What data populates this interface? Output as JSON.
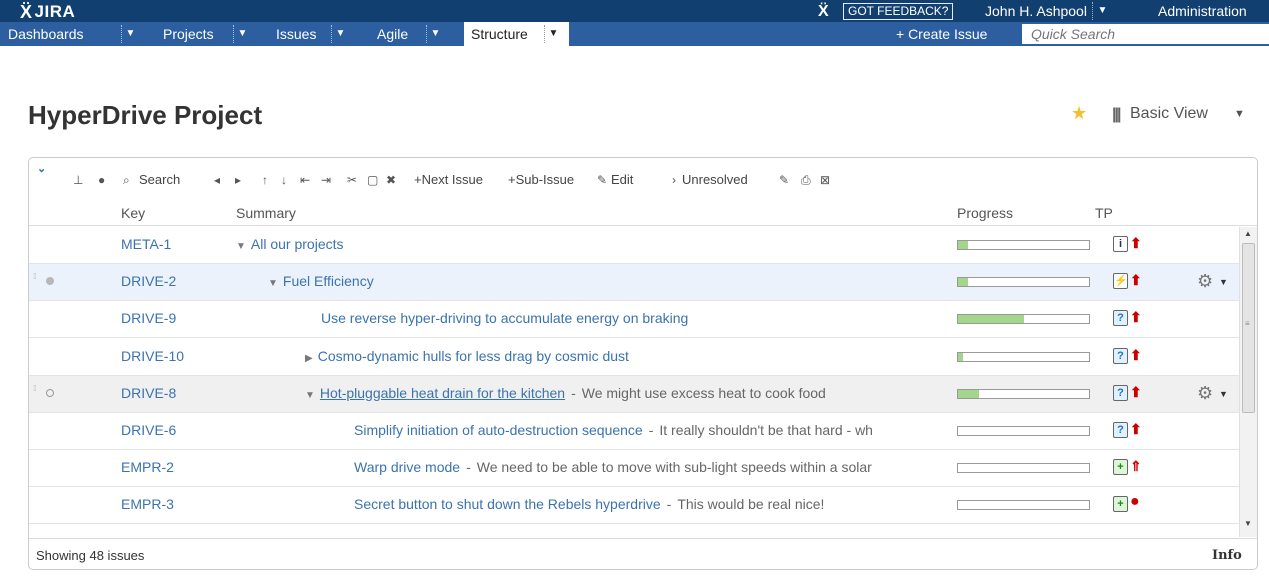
{
  "app": {
    "logo_text": "JIRA",
    "feedback_label": "GOT FEEDBACK?",
    "user_name": "John H. Ashpool",
    "admin_label": "Administration"
  },
  "nav": {
    "items": [
      {
        "label": "Dashboards"
      },
      {
        "label": "Projects"
      },
      {
        "label": "Issues"
      },
      {
        "label": "Agile"
      },
      {
        "label": "Structure"
      }
    ],
    "create_label": "+ Create Issue",
    "quick_search_placeholder": "Quick Search"
  },
  "page": {
    "title": "HyperDrive Project",
    "view_label": "Basic View"
  },
  "toolbar": {
    "search": "Search",
    "next_issue": "+Next Issue",
    "sub_issue": "+Sub-Issue",
    "edit": "Edit",
    "unresolved": "Unresolved"
  },
  "columns": {
    "key": "Key",
    "summary": "Summary",
    "progress": "Progress",
    "tp": "TP"
  },
  "rows": [
    {
      "key": "META-1",
      "arrow": "▼",
      "summary": "All our projects",
      "desc": "",
      "progress": 0.08,
      "type": "info",
      "priority": "major"
    },
    {
      "key": "DRIVE-2",
      "arrow": "▼",
      "summary": "Fuel Efficiency",
      "desc": "",
      "progress": 0.08,
      "type": "epic",
      "priority": "major"
    },
    {
      "key": "DRIVE-9",
      "arrow": "",
      "summary": "Use reverse hyper-driving to accumulate energy on braking",
      "desc": "",
      "progress": 0.5,
      "type": "improvement",
      "priority": "major"
    },
    {
      "key": "DRIVE-10",
      "arrow": "▶",
      "summary": "Cosmo-dynamic hulls for less drag by cosmic dust",
      "desc": "",
      "progress": 0.04,
      "type": "improvement",
      "priority": "major"
    },
    {
      "key": "DRIVE-8",
      "arrow": "▼",
      "summary": "Hot-pluggable heat drain for the kitchen",
      "sep": "-",
      "desc": "We might use excess heat to cook food",
      "progress": 0.16,
      "type": "improvement",
      "priority": "major"
    },
    {
      "key": "DRIVE-6",
      "arrow": "",
      "summary": "Simplify initiation of auto-destruction sequence",
      "sep": "-",
      "desc": "It really shouldn't be that hard - wh",
      "progress": 0,
      "type": "improvement",
      "priority": "major"
    },
    {
      "key": "EMPR-2",
      "arrow": "",
      "summary": "Warp drive mode",
      "sep": "-",
      "desc": "We need to be able to move with sub-light speeds within a solar",
      "progress": 0,
      "type": "new-feature",
      "priority": "minor-up"
    },
    {
      "key": "EMPR-3",
      "arrow": "",
      "summary": "Secret button to shut down the Rebels hyperdrive",
      "sep": "-",
      "desc": "This would be real nice!",
      "progress": 0,
      "type": "new-feature",
      "priority": "blocker"
    }
  ],
  "footer": {
    "showing": "Showing 48 issues",
    "info": "Info"
  },
  "colors": {
    "header_bg": "#114070",
    "nav_bg": "#2c5ea0",
    "link": "#3b73af",
    "progress_fill": "#a3d68a",
    "priority": "#cc0000"
  }
}
